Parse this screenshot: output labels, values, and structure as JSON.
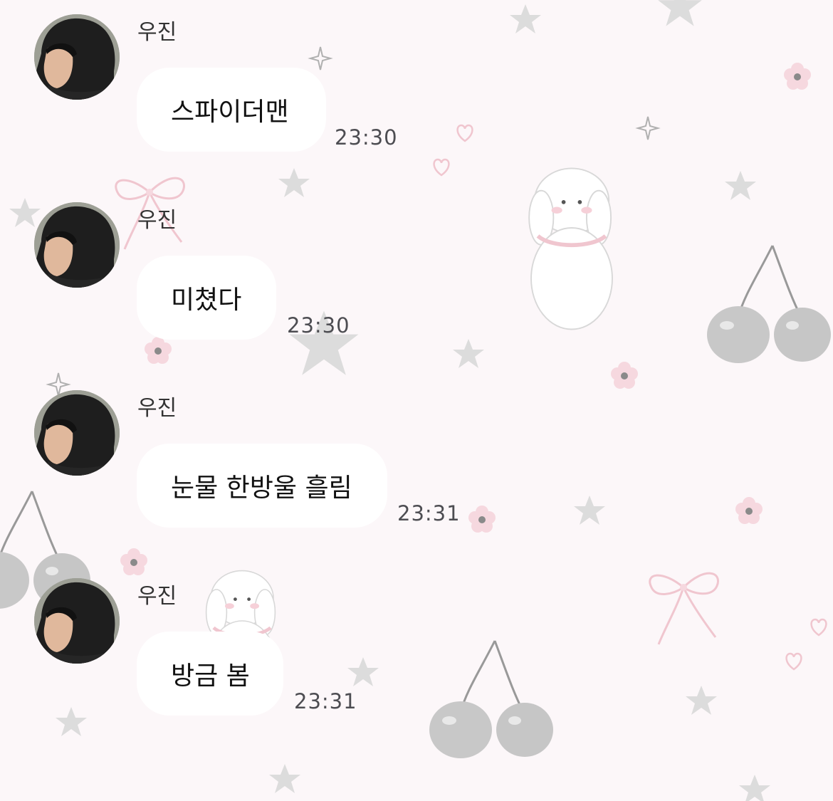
{
  "chat": {
    "messages": [
      {
        "sender": "우진",
        "text": "스파이더맨",
        "time": "23:30"
      },
      {
        "sender": "우진",
        "text": "미쳤다",
        "time": "23:30"
      },
      {
        "sender": "우진",
        "text": "눈물 한방울 흘림",
        "time": "23:31"
      },
      {
        "sender": "우진",
        "text": "방금 봄",
        "time": "23:31"
      }
    ]
  },
  "colors": {
    "background": "#fcf7f9",
    "bubble": "#ffffff",
    "time_text": "#4d4d52",
    "sender_text": "#333333"
  },
  "wallpaper": {
    "motifs": [
      "cherry-icon",
      "bow-icon",
      "star-icon",
      "flower-icon",
      "heart-icon",
      "bunny-icon",
      "sparkle-icon"
    ]
  }
}
